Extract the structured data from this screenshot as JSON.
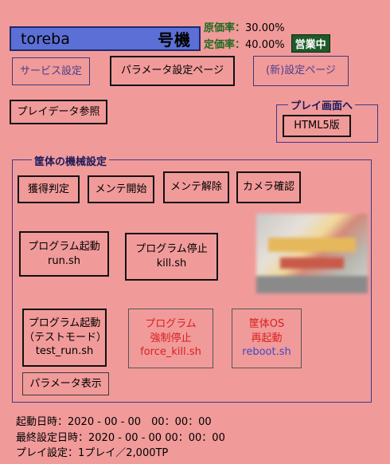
{
  "header": {
    "store_name": "toreba",
    "machine_label": "号機",
    "cost_rate_label": "原価率：",
    "cost_rate_value": "30.00%",
    "fixed_rate_label": "定価率：",
    "fixed_rate_value": "40.00%",
    "status": "営業中"
  },
  "top_buttons": {
    "service_settings": "サービス設定",
    "parameter_settings": "パラメータ設定ページ",
    "new_settings": "(新)設定ページ",
    "play_data": "プレイデータ参照"
  },
  "play_screen": {
    "legend": "プレイ画面へ",
    "html5": "HTML5版"
  },
  "machine_settings": {
    "legend": "筐体の機械設定",
    "acquire_judge": "獲得判定",
    "maint_start": "メンテ開始",
    "maint_release": "メンテ解除",
    "camera_check": "カメラ確認",
    "program_start_title": "プログラム起動",
    "program_start_file": "run.sh",
    "program_stop_title": "プログラム停止",
    "program_stop_file": "kill.sh",
    "program_test_title": "プログラム起動",
    "program_test_sub": "（テストモード）",
    "program_test_file": "test_run.sh",
    "force_title": "プログラム",
    "force_sub": "強制停止",
    "force_file": "force_kill.sh",
    "reboot_title": "筐体OS",
    "reboot_sub": "再起動",
    "reboot_file": "reboot.sh",
    "show_params": "パラメータ表示"
  },
  "info": {
    "start_time": "起動日時：2020 - 00 - 00　00：00：00",
    "last_setting": "最終設定日時：2020 - 00 - 00 00：00：00",
    "play_setting": "プレイ設定：1プレイ／2,000TP"
  },
  "colors": {
    "background": "#f19a9a",
    "title_bar": "#5b6fd6",
    "status_badge": "#1f5a2a",
    "danger_text": "#d92020",
    "link_text": "#3f48c8"
  }
}
